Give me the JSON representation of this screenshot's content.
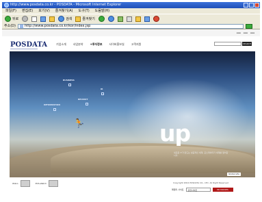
{
  "window": {
    "title": "http://www.posdata.co.kr - POSDATA - Microsoft Internet Explorer",
    "address": "http://www.posdata.co.kr/kor/index.jsp"
  },
  "menubar": {
    "items": [
      "파일(F)",
      "편집(E)",
      "보기(V)",
      "즐겨찾기(A)",
      "도구(T)",
      "도움말(H)"
    ]
  },
  "toolbar": {
    "back_label": "뒤로",
    "search_label": "검색",
    "favorites_label": "즐겨찾기"
  },
  "addressbar": {
    "label": "주소(D)"
  },
  "site": {
    "logo": "POSDATA",
    "nav": [
      "기업소개",
      "사업분야",
      "+투자정보",
      "사이버홍보실",
      "고객지원"
    ],
    "search_button": "SEARCH",
    "hero": {
      "labels": {
        "business": "BUSINESS",
        "ir": "IR",
        "recruit": "RECRUIT",
        "information": "INFORMATION"
      },
      "headline": "up",
      "caption": "새로운 IT가 만드는 성공적인 세계, 포스데이타가 세계를 열어갑니다."
    },
    "more": "Global site",
    "footer": {
      "copyright": "Copyright 2004 POSDATA CO., LTD. All Right Reserved",
      "logo1": "Wibro",
      "logo2": "POS-Watch",
      "select_label": "패밀리 사이트",
      "select_value": "관련사이트",
      "pr_button": "PR MOVIES"
    }
  }
}
